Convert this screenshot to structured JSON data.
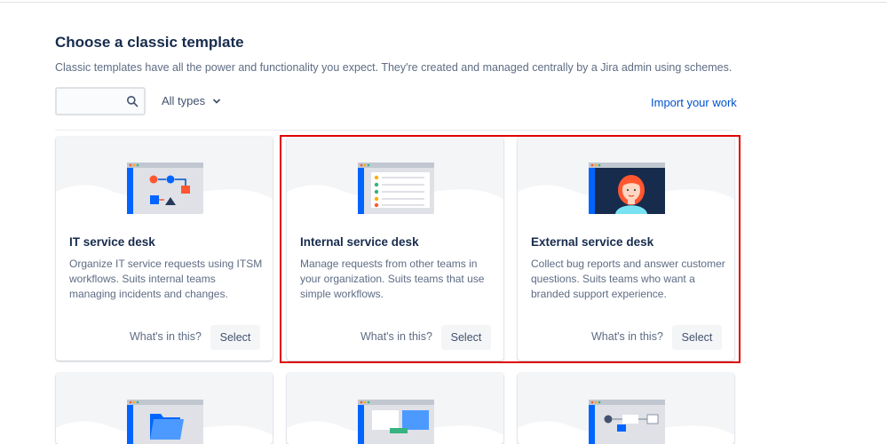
{
  "header": {
    "title": "Choose a classic template",
    "subtitle": "Classic templates have all the power and functionality you expect. They're created and managed centrally by a Jira admin using schemes."
  },
  "toolbar": {
    "search_placeholder": "",
    "search_value": "",
    "type_filter": "All types",
    "import_link": "Import your work"
  },
  "cards": [
    {
      "name": "IT service desk",
      "description": "Organize IT service requests using ITSM workflows. Suits internal teams managing incidents and changes.",
      "whats_in_this": "What's in this?",
      "select": "Select",
      "illustration": "workflow-diagram-icon"
    },
    {
      "name": "Internal service desk",
      "description": "Manage requests from other teams in your organization. Suits teams that use simple workflows.",
      "whats_in_this": "What's in this?",
      "select": "Select",
      "illustration": "request-list-icon"
    },
    {
      "name": "External service desk",
      "description": "Collect bug reports and answer customer questions. Suits teams who want a branded support experience.",
      "whats_in_this": "What's in this?",
      "select": "Select",
      "illustration": "customer-avatar-icon"
    }
  ],
  "partial_cards": [
    {
      "illustration": "folder-icon"
    },
    {
      "illustration": "dashboard-icon"
    },
    {
      "illustration": "flow-icon"
    }
  ],
  "colors": {
    "accent": "#0052cc",
    "highlight_border": "#e00000",
    "text_primary": "#172b4d",
    "text_secondary": "#5e6c84"
  }
}
